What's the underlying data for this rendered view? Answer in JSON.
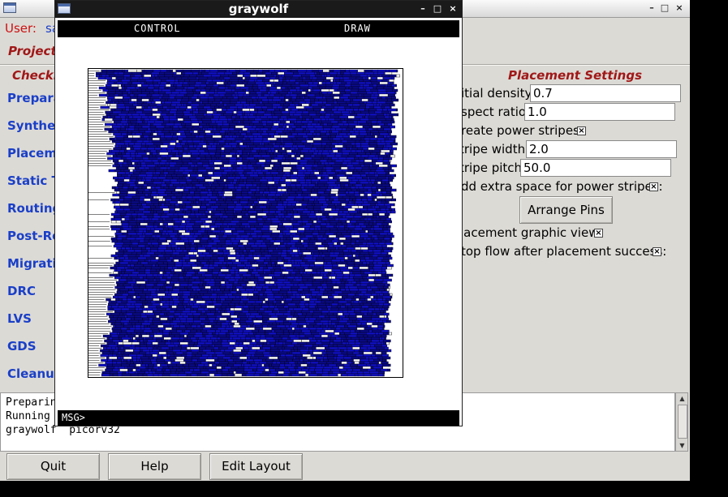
{
  "main_window": {
    "user_label": "User:",
    "user_value": "sa",
    "project_label": "Project:",
    "checklist_title": "Checkl",
    "steps": [
      "Prepara",
      "Synthes",
      "Placeme",
      "Static Ti",
      "Routing",
      "Post-Ro",
      "Migratio",
      "DRC",
      "LVS",
      "GDS",
      "Cleanup"
    ],
    "placement_settings": {
      "title": "Placement Settings",
      "initial_density_label": "itial density:",
      "initial_density_value": "0.7",
      "aspect_ratio_label": "spect ratio:",
      "aspect_ratio_value": "1.0",
      "power_stripes_label": "reate power stripes:",
      "power_stripes_checked": true,
      "stripe_width_label": "tripe width:",
      "stripe_width_value": "2.0",
      "stripe_pitch_label": "tripe pitch:",
      "stripe_pitch_value": "50.0",
      "extra_space_label": "dd extra space for power stripes:",
      "extra_space_checked": true,
      "arrange_pins_button": "Arrange Pins",
      "graphic_view_label": "lacement graphic view:",
      "graphic_view_checked": true,
      "stop_flow_label": "top flow after placement success:",
      "stop_flow_checked": true
    },
    "log_lines": [
      "Preparin",
      "Running",
      "graywolf  picorv32"
    ],
    "buttons": {
      "quit": "Quit",
      "help": "Help",
      "edit_layout": "Edit Layout"
    },
    "check_mark": "×",
    "wm_minimize": "–",
    "wm_maximize": "□",
    "wm_close": "×",
    "scroll_up": "▲",
    "scroll_down": "▼"
  },
  "graywolf_window": {
    "title": "graywolf",
    "menu_control": "CONTROL",
    "menu_draw": "DRAW",
    "msg_prompt": "MSG>",
    "cell_color": "#1010c8",
    "cell_color_dark": "#0a0a8c",
    "outline_color": "#000000"
  },
  "colors": {
    "section_title": "#a01818",
    "step_link": "#1a3fc8",
    "user_label": "#cc1111",
    "window_bg": "#dcdad5"
  }
}
